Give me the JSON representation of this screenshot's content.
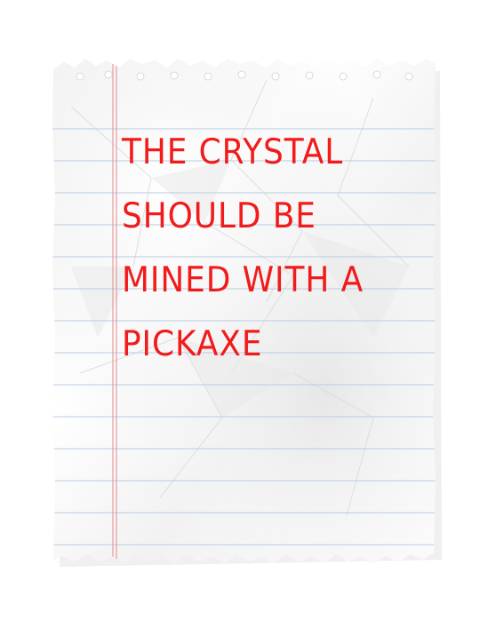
{
  "note": {
    "lines": [
      "THE CRYSTAL",
      "SHOULD BE",
      "MINED WITH A",
      "PICKAXE"
    ]
  },
  "colors": {
    "ink": "#f21a1a",
    "rule_lines": "#b9cde3",
    "margin_line": "#e58a8a",
    "paper": "#fafafa"
  }
}
